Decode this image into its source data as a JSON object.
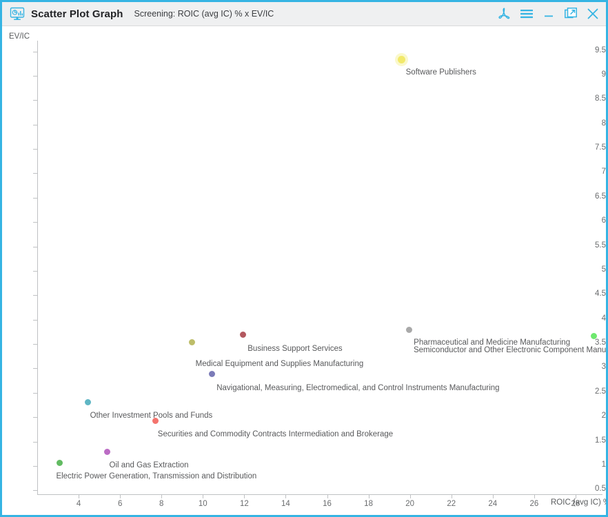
{
  "window": {
    "title": "Scatter Plot Graph",
    "subtitle": "Screening:  ROIC (avg IC) % x EV/IC",
    "app_icon": "chart-monitor-icon",
    "accent_color": "#35b4e3",
    "header_bg": "#eff0f1",
    "actions": [
      {
        "name": "pdf-export-icon",
        "label": "PDF"
      },
      {
        "name": "menu-icon",
        "label": "Menu"
      },
      {
        "name": "minimize-icon",
        "label": "Minimize"
      },
      {
        "name": "popout-icon",
        "label": "Open in new window"
      },
      {
        "name": "close-icon",
        "label": "Close"
      }
    ]
  },
  "chart_data": {
    "type": "scatter",
    "title": "Scatter Plot Graph",
    "subtitle": "Screening:  ROIC (avg IC) % x EV/IC",
    "xlabel": "ROIC (avg IC) %",
    "ylabel": "EV/IC",
    "xlim": [
      2,
      29.3
    ],
    "ylim": [
      0.42,
      9.72
    ],
    "grid": false,
    "legend": "none",
    "xticks": [
      4,
      6,
      8,
      10,
      12,
      14,
      16,
      18,
      20,
      22,
      24,
      26,
      28
    ],
    "yticks": [
      0.5,
      1,
      1.5,
      2,
      2.5,
      3,
      3.5,
      4,
      4.5,
      5,
      5.5,
      6,
      6.5,
      7,
      7.5,
      8,
      8.5,
      9,
      9.5
    ],
    "points": [
      {
        "label": "Software Publishers",
        "x": 19.6,
        "y": 9.33,
        "color": "#f2e96a",
        "highlight": true,
        "label_dx": 6,
        "label_dy": 12
      },
      {
        "label": "Pharmaceutical and Medicine Manufacturing",
        "x": 19.95,
        "y": 3.79,
        "color": "#a9a9a9",
        "highlight": false,
        "label_dx": 7,
        "label_dy": 12
      },
      {
        "label": "Semiconductor and Other Electronic Component Manufacturing",
        "x": 28.9,
        "y": 3.66,
        "color": "#6ee86e",
        "highlight": false,
        "label_dx": -262,
        "label_dy": 14
      },
      {
        "label": "Business Support Services",
        "x": 11.93,
        "y": 3.69,
        "color": "#b3585f",
        "highlight": false,
        "label_dx": 7,
        "label_dy": 14
      },
      {
        "label": "Medical Equipment and Supplies Manufacturing",
        "x": 9.48,
        "y": 3.53,
        "color": "#bdbd69",
        "highlight": false,
        "label_dx": 5,
        "label_dy": 25
      },
      {
        "label": "Navigational, Measuring, Electromedical, and Control Instruments Manufacturing",
        "x": 10.43,
        "y": 2.88,
        "color": "#7b7bb8",
        "highlight": false,
        "label_dx": 7,
        "label_dy": 14
      },
      {
        "label": "Other Investment Pools and Funds",
        "x": 4.45,
        "y": 2.31,
        "color": "#5fb6c4",
        "highlight": false,
        "label_dx": 3,
        "label_dy": 14
      },
      {
        "label": "Securities and Commodity Contracts Intermediation and Brokerage",
        "x": 7.72,
        "y": 1.93,
        "color": "#f4736d",
        "highlight": false,
        "label_dx": 3,
        "label_dy": 14
      },
      {
        "label": "Oil and Gas Extraction",
        "x": 5.38,
        "y": 1.29,
        "color": "#bb6bc4",
        "highlight": false,
        "label_dx": 3,
        "label_dy": 14
      },
      {
        "label": "Electric Power Generation, Transmission and Distribution",
        "x": 3.08,
        "y": 1.07,
        "color": "#62bb62",
        "highlight": false,
        "label_dx": -5,
        "label_dy": 14
      }
    ]
  }
}
